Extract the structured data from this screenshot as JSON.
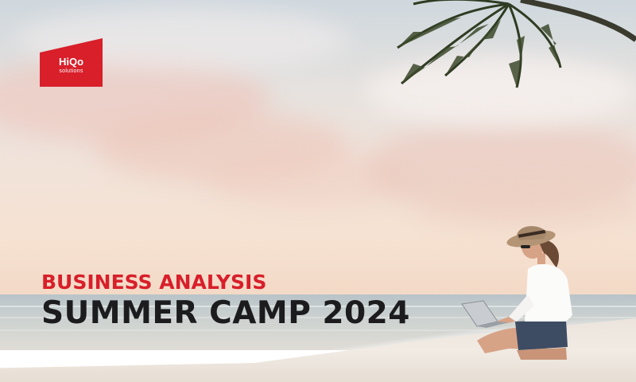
{
  "logo": {
    "name": "HiQo",
    "subtitle": "solutions",
    "color": "#d81f2a"
  },
  "banner": {
    "subtitle": "BUSINESS ANALYSIS",
    "title": "SUMMER CAMP 2024"
  },
  "colors": {
    "accent": "#d81f2a",
    "title": "#1c1c1e"
  }
}
